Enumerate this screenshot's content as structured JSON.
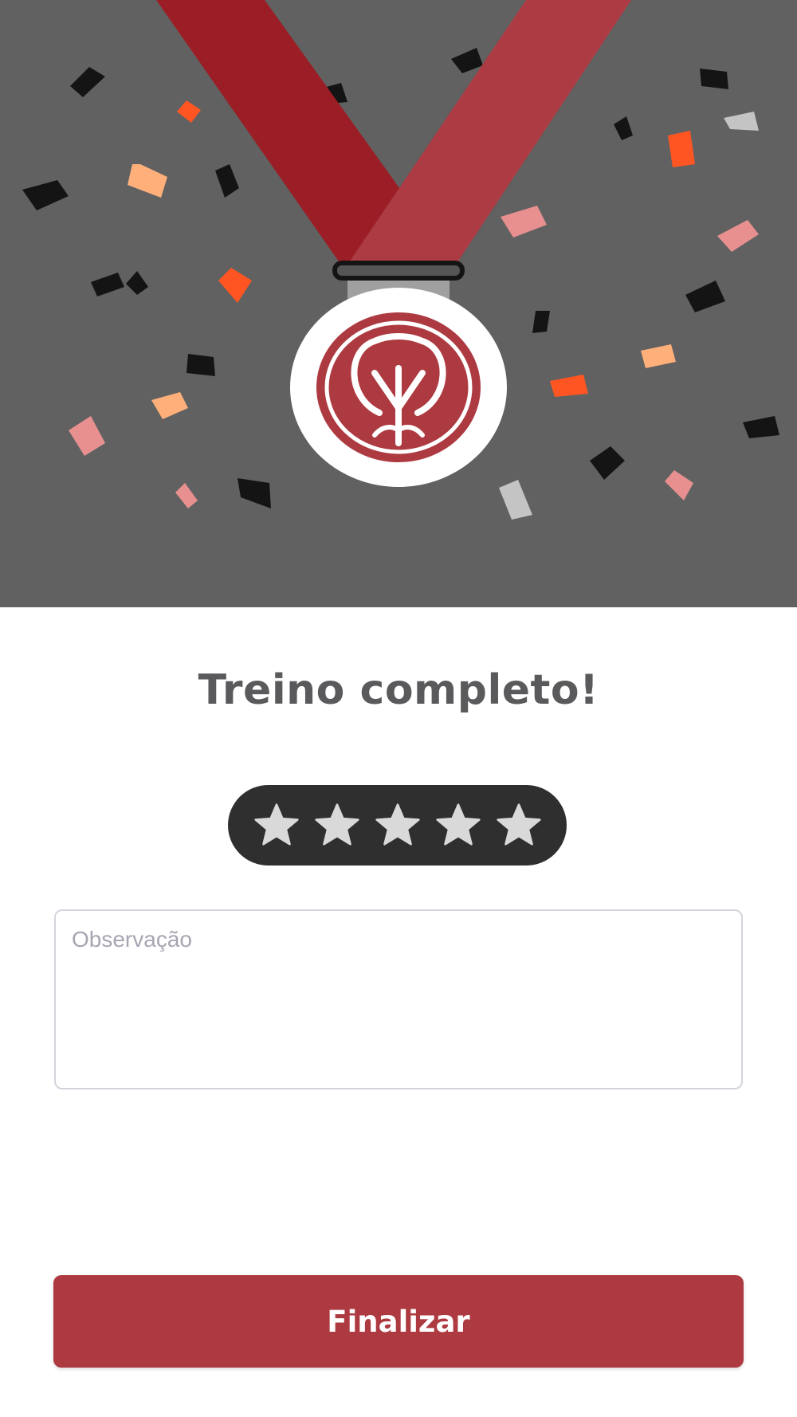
{
  "hero": {
    "icon": "medal-icon",
    "background": "#616161",
    "ribbon_colors": [
      "#9b1d25",
      "#ac3b43"
    ],
    "confetti_colors": [
      "#141414",
      "#ff5522",
      "#ffb07a",
      "#e89090",
      "#c4c4c4"
    ]
  },
  "title": "Treino completo!",
  "rating": {
    "icon": "star-icon",
    "max_stars": 5,
    "selected_stars": 0,
    "background": "#2f2f2f",
    "star_color": "#d9d9d9"
  },
  "observation": {
    "placeholder": "Observação",
    "value": ""
  },
  "finish_button": {
    "label": "Finalizar",
    "color": "#ad3a40"
  }
}
